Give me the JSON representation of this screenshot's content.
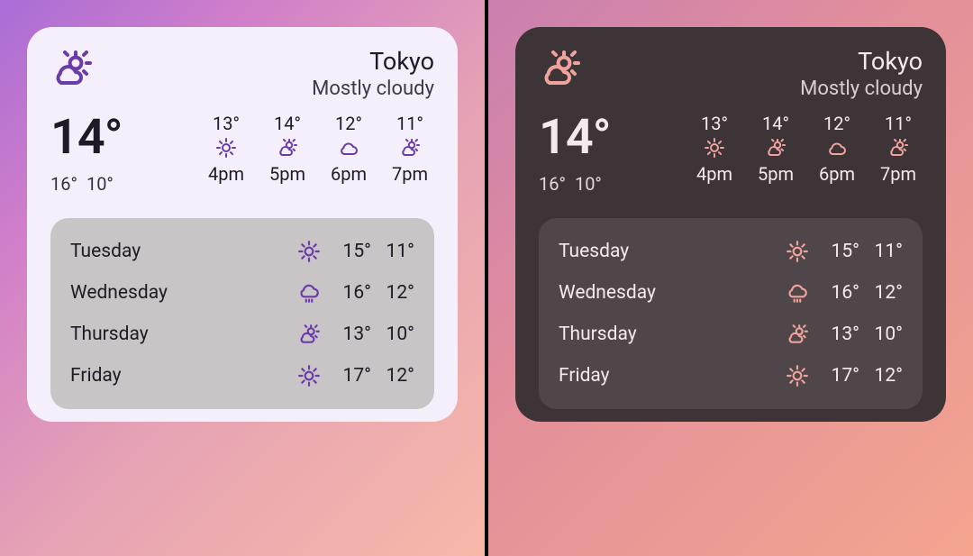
{
  "location": {
    "city": "Tokyo",
    "condition": "Mostly cloudy"
  },
  "current": {
    "temp": "14°",
    "hi": "16°",
    "lo": "10°",
    "icon": "partly-cloudy"
  },
  "hourly": [
    {
      "temp": "13°",
      "icon": "sunny",
      "label": "4pm"
    },
    {
      "temp": "14°",
      "icon": "partly-cloudy",
      "label": "5pm"
    },
    {
      "temp": "12°",
      "icon": "cloudy",
      "label": "6pm"
    },
    {
      "temp": "11°",
      "icon": "partly-cloudy",
      "label": "7pm"
    }
  ],
  "daily": [
    {
      "day": "Tuesday",
      "icon": "sunny",
      "hi": "15°",
      "lo": "11°"
    },
    {
      "day": "Wednesday",
      "icon": "rain",
      "hi": "16°",
      "lo": "12°"
    },
    {
      "day": "Thursday",
      "icon": "partly-cloudy",
      "hi": "13°",
      "lo": "10°"
    },
    {
      "day": "Friday",
      "icon": "sunny",
      "hi": "17°",
      "lo": "12°"
    }
  ],
  "themes": [
    "light",
    "dark"
  ]
}
